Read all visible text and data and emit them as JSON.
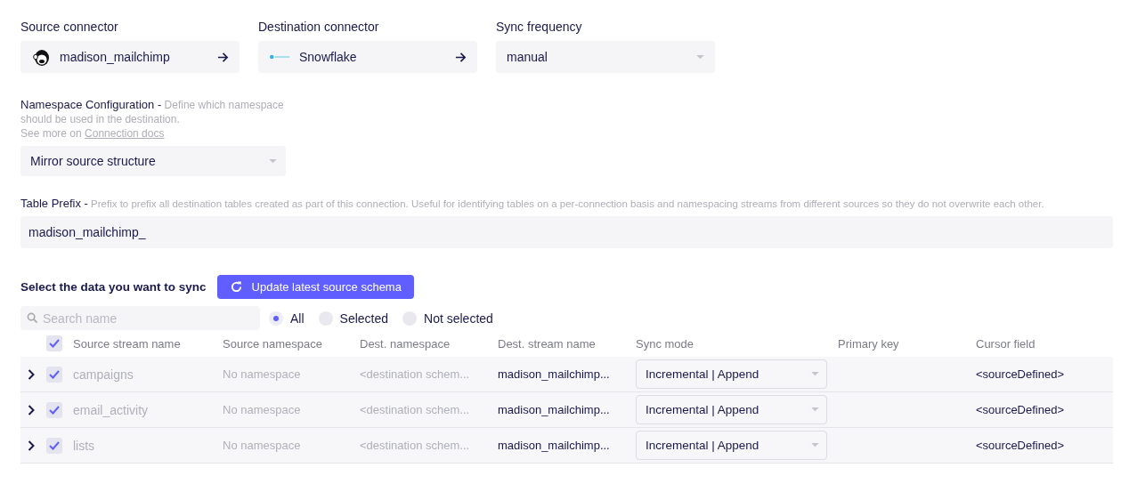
{
  "connectors": [
    {
      "label": "Source connector",
      "kind": "link",
      "value": "madison_mailchimp"
    },
    {
      "label": "Destination connector",
      "kind": "link",
      "value": "Snowflake"
    },
    {
      "label": "Sync frequency",
      "kind": "select",
      "value": "manual"
    }
  ],
  "namespace": {
    "label": "Namespace Configuration -",
    "description": "Define which namespace should be used in the destination.",
    "see_more": "See more on",
    "link": "Connection docs",
    "value": "Mirror source structure"
  },
  "table_prefix": {
    "label": "Table Prefix -",
    "description": "Prefix to prefix all destination tables created as part of this connection. Useful for identifying tables on a per-connection basis and namespacing streams from different sources so they do not overwrite each other.",
    "value": "madison_mailchimp_"
  },
  "streams": {
    "title": "Select the data you want to sync",
    "update_button": "Update latest source schema",
    "search": {
      "placeholder": "Search name"
    },
    "filters": [
      {
        "label": "All",
        "selected": true
      },
      {
        "label": "Selected",
        "selected": false
      },
      {
        "label": "Not selected",
        "selected": false
      }
    ],
    "select_all_checked": true,
    "columns": [
      "Source stream name",
      "Source namespace",
      "Dest. namespace",
      "Dest. stream name",
      "Sync mode",
      "Primary key",
      "Cursor field"
    ],
    "rows": [
      {
        "expanded": false,
        "checked": true,
        "name": "campaigns",
        "source_namespace": "No namespace",
        "dest_namespace": "<destination schem...",
        "dest_stream": "madison_mailchimp...",
        "sync_mode": "Incremental | Append",
        "cursor_field": "<sourceDefined>"
      },
      {
        "expanded": false,
        "checked": true,
        "name": "email_activity",
        "source_namespace": "No namespace",
        "dest_namespace": "<destination schem...",
        "dest_stream": "madison_mailchimp...",
        "sync_mode": "Incremental | Append",
        "cursor_field": "<sourceDefined>"
      },
      {
        "expanded": false,
        "checked": true,
        "name": "lists",
        "source_namespace": "No namespace",
        "dest_namespace": "<destination schem...",
        "dest_stream": "madison_mailchimp...",
        "sync_mode": "Incremental | Append",
        "cursor_field": "<sourceDefined>"
      }
    ]
  }
}
